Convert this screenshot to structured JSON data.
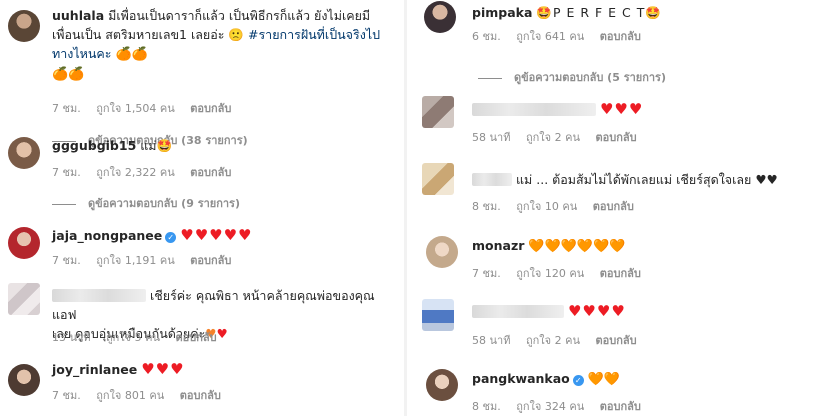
{
  "left": [
    {
      "username": "uuhlala",
      "text": "มีเพื่อนเป็นดาราก็แล้ว เป็นพิธีกรก็แล้ว ยังไม่เคยมีเพื่อนเป็น สตริมหายเลข1 เลยอ่ะ 🙁",
      "hashtag": "#รายการฝันที่เป็นจริงไปทางไหนคะ",
      "emoji_tail": "🍊🍊",
      "emoji_line2": "🍊🍊",
      "time": "7 ชม.",
      "likes": "ถูกใจ 1,504 คน",
      "reply": "ตอบกลับ",
      "view_replies": "ดูข้อความตอบกลับ (38 รายการ)"
    },
    {
      "username": "gggubgib15",
      "text": "แม่🤩",
      "time": "7 ชม.",
      "likes": "ถูกใจ 2,322 คน",
      "reply": "ตอบกลับ",
      "view_replies": "ดูข้อความตอบกลับ (9 รายการ)"
    },
    {
      "username": "jaja_nongpanee",
      "text": "♥♥♥♥♥",
      "time": "7 ชม.",
      "likes": "ถูกใจ 1,191 คน",
      "reply": "ตอบกลับ"
    },
    {
      "username": "",
      "text": "เชียร์ค่ะ คุณพิธา หน้าคล้ายคุณพ่อของคุณแอฟ",
      "text2": "เลย ดูอบอุ่นเหมือนกันด้วยค่ะ",
      "time": "13 นาที",
      "likes": "ถูกใจ 5 คน",
      "reply": "ตอบกลับ"
    },
    {
      "username": "joy_rinlanee",
      "text": "♥♥♥",
      "time": "7 ชม.",
      "likes": "ถูกใจ 801 คน",
      "reply": "ตอบกลับ"
    }
  ],
  "right": [
    {
      "username": "pimpaka",
      "text": "🤩P E R F E C T🤩",
      "time": "6 ชม.",
      "likes": "ถูกใจ 641 คน",
      "reply": "ตอบกลับ",
      "view_replies": "ดูข้อความตอบกลับ (5 รายการ)"
    },
    {
      "username": "",
      "text": "♥♥♥",
      "time": "58 นาที",
      "likes": "ถูกใจ 2 คน",
      "reply": "ตอบกลับ"
    },
    {
      "username": "",
      "text": "แม่ ... ต้อมส้มไม่ได้พักเลยแม่ เชียร์สุดใจเลย ♥♥",
      "time": "8 ชม.",
      "likes": "ถูกใจ 10 คน",
      "reply": "ตอบกลับ"
    },
    {
      "username": "monazr",
      "text": "🧡🧡🧡🧡🧡🧡",
      "time": "7 ชม.",
      "likes": "ถูกใจ 120 คน",
      "reply": "ตอบกลับ"
    },
    {
      "username": "",
      "text": "♥♥♥♥",
      "time": "58 นาที",
      "likes": "ถูกใจ 2 คน",
      "reply": "ตอบกลับ"
    },
    {
      "username": "pangkwankao",
      "text": "🧡🧡",
      "time": "8 ชม.",
      "likes": "ถูกใจ 324 คน",
      "reply": "ตอบกลับ"
    }
  ],
  "colors": {
    "red_heart": "#ed1c24",
    "orange_heart": "#f5822a",
    "verified": "#3897f0",
    "muted": "#8e8e8e",
    "hashtag": "#00376b"
  }
}
